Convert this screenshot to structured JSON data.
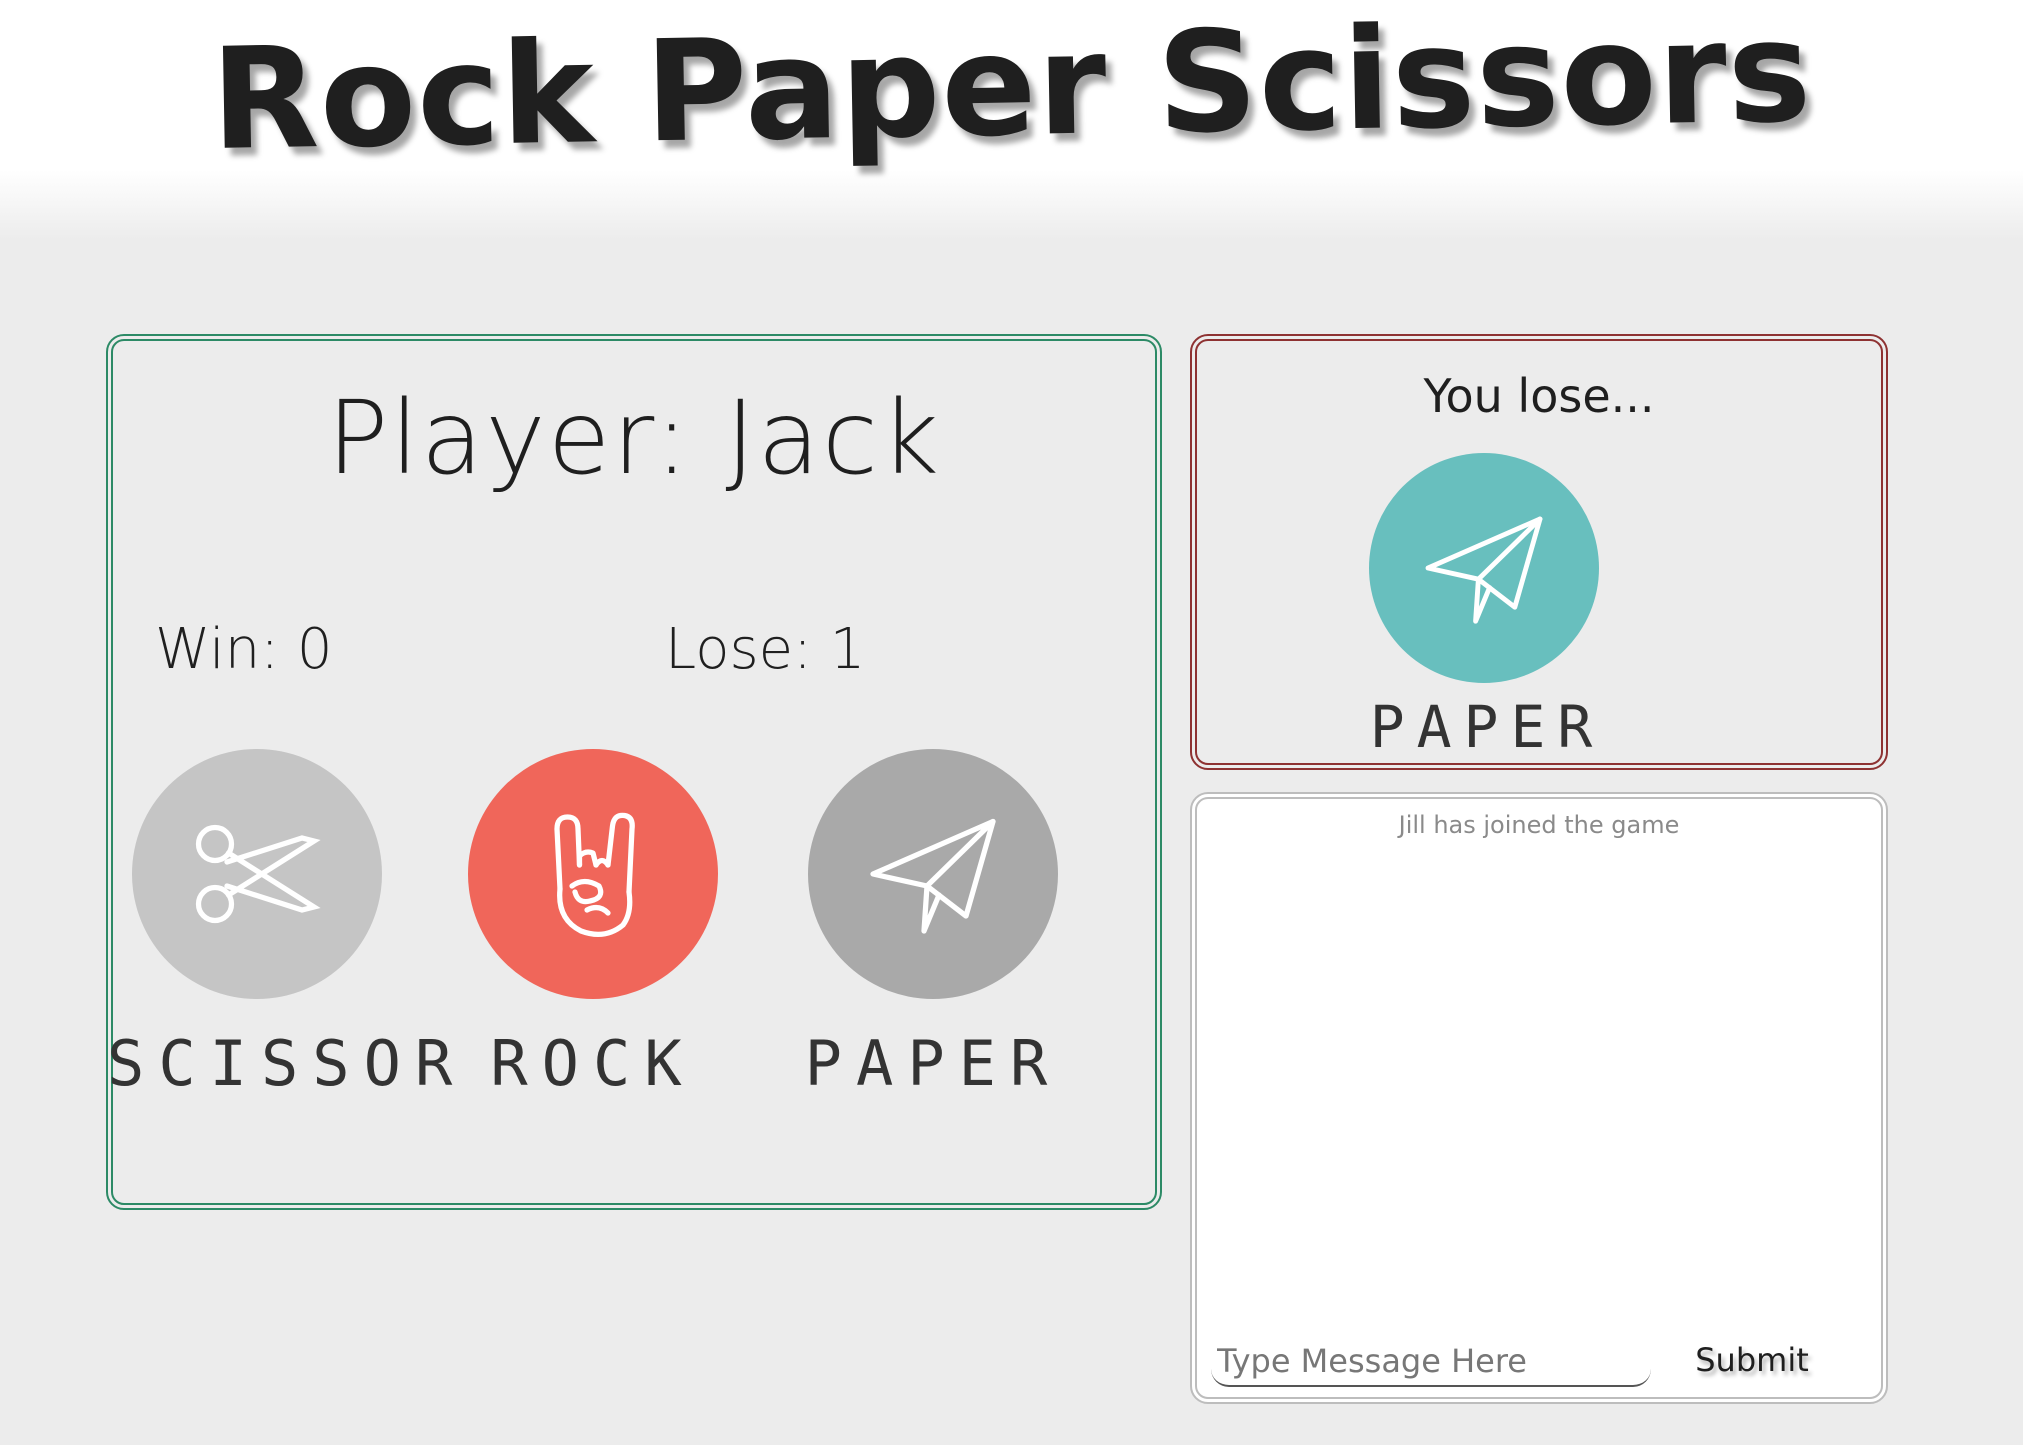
{
  "header": {
    "title": "Rock Paper Scissors"
  },
  "player": {
    "name_label": "Player: Jack",
    "win_label": "Win: 0",
    "lose_label": "Lose: 1",
    "choices": [
      {
        "label": "SCISSOR",
        "icon": "scissors-icon",
        "color": "#c5c5c5",
        "selected": false
      },
      {
        "label": "ROCK",
        "icon": "rock-hand-icon",
        "color": "#f0665a",
        "selected": true
      },
      {
        "label": "PAPER",
        "icon": "paper-plane-icon",
        "color": "#a9a9a9",
        "selected": false
      }
    ]
  },
  "result": {
    "text": "You lose...",
    "opponent_choice_label": "PAPER",
    "opponent_choice_icon": "paper-plane-icon",
    "opponent_choice_color": "#68bfbe"
  },
  "chat": {
    "messages": [
      "Jill has joined the game"
    ],
    "input_placeholder": "Type Message Here",
    "submit_label": "Submit"
  },
  "colors": {
    "player_border": "#2c8a66",
    "result_border": "#8e3232",
    "chat_border": "#bdbdbd",
    "page_background": "#ececec"
  }
}
